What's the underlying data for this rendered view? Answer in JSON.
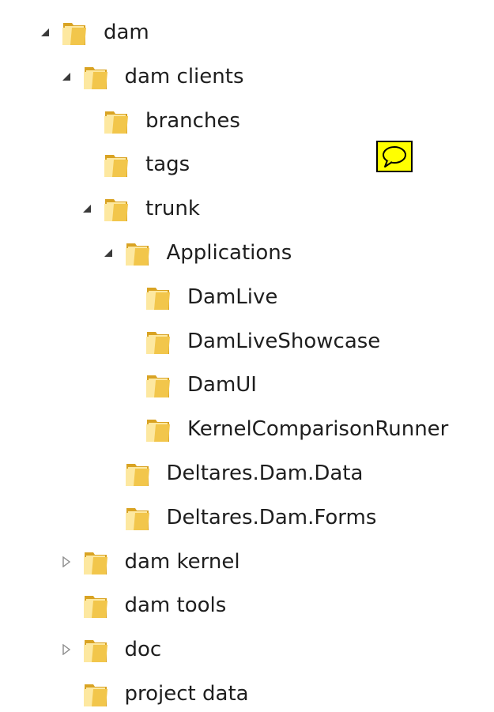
{
  "tree": [
    {
      "id": "dam",
      "label": "dam",
      "depth": 0,
      "expander": "expanded"
    },
    {
      "id": "dam-clients",
      "label": "dam clients",
      "depth": 1,
      "expander": "expanded"
    },
    {
      "id": "branches",
      "label": "branches",
      "depth": 2,
      "expander": "none"
    },
    {
      "id": "tags",
      "label": "tags",
      "depth": 2,
      "expander": "none"
    },
    {
      "id": "trunk",
      "label": "trunk",
      "depth": 2,
      "expander": "expanded"
    },
    {
      "id": "applications",
      "label": "Applications",
      "depth": 3,
      "expander": "expanded"
    },
    {
      "id": "damlive",
      "label": "DamLive",
      "depth": 4,
      "expander": "none"
    },
    {
      "id": "damliveshowcase",
      "label": "DamLiveShowcase",
      "depth": 4,
      "expander": "none"
    },
    {
      "id": "damui",
      "label": "DamUI",
      "depth": 4,
      "expander": "none"
    },
    {
      "id": "kernelcomparisonrunner",
      "label": "KernelComparisonRunner",
      "depth": 4,
      "expander": "none"
    },
    {
      "id": "deltares-dam-data",
      "label": "Deltares.Dam.Data",
      "depth": 3,
      "expander": "none"
    },
    {
      "id": "deltares-dam-forms",
      "label": "Deltares.Dam.Forms",
      "depth": 3,
      "expander": "none"
    },
    {
      "id": "dam-kernel",
      "label": "dam kernel",
      "depth": 1,
      "expander": "collapsed"
    },
    {
      "id": "dam-tools",
      "label": "dam tools",
      "depth": 1,
      "expander": "none"
    },
    {
      "id": "doc",
      "label": "doc",
      "depth": 1,
      "expander": "collapsed"
    },
    {
      "id": "project-data",
      "label": "project data",
      "depth": 1,
      "expander": "none"
    }
  ],
  "icons": {
    "folder": "folder-icon",
    "expanded": "expanded-arrow-icon",
    "collapsed": "collapsed-arrow-icon",
    "comment": "speech-bubble-icon"
  },
  "colors": {
    "folder_light": "#fde8a0",
    "folder_mid": "#f2c64b",
    "folder_dark": "#d9a323",
    "arrow_fill": "#3a3a3a",
    "arrow_outline": "#8c8c8c",
    "comment_bg": "#ffff00"
  }
}
